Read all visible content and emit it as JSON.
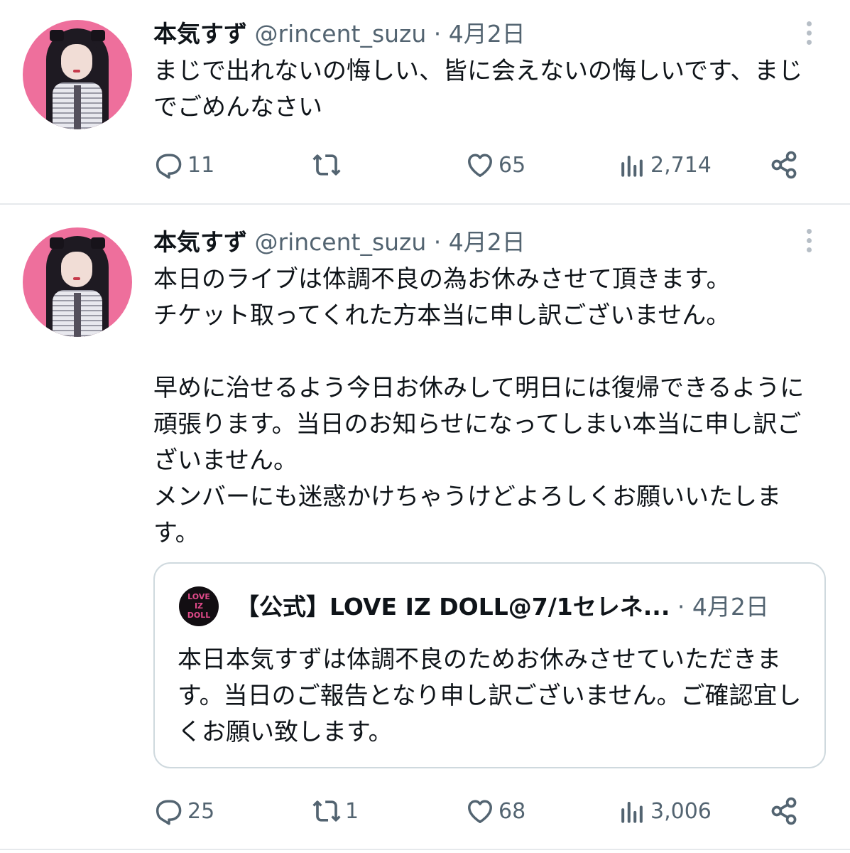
{
  "tweets": [
    {
      "author_name": "本気すず",
      "handle": "@rincent_suzu",
      "separator": "·",
      "date": "4月2日",
      "text": "まじで出れないの悔しい、皆に会えないの悔しいです、まじでごめんなさい",
      "reply_count": "11",
      "retweet_count": "",
      "like_count": "65",
      "view_count": "2,714"
    },
    {
      "author_name": "本気すず",
      "handle": "@rincent_suzu",
      "separator": "·",
      "date": "4月2日",
      "text": "本日のライブは体調不良の為お休みさせて頂きます。\nチケット取ってくれた方本当に申し訳ございません。\n\n早めに治せるよう今日お休みして明日には復帰できるように頑張ります。当日のお知らせになってしまい本当に申し訳ございません。\nメンバーにも迷惑かけちゃうけどよろしくお願いいたします。",
      "quote": {
        "author_name": "【公式】LOVE IZ DOLL@7/1セレネ...",
        "separator": "·",
        "date": "4月2日",
        "avatar_text": [
          "LOVE",
          "IZ",
          "DOLL"
        ],
        "text": "本日本気すずは体調不良のためお休みさせていただきます。当日のご報告となり申し訳ございません。ご確認宜しくお願い致します。"
      },
      "reply_count": "25",
      "retweet_count": "1",
      "like_count": "68",
      "view_count": "3,006"
    }
  ],
  "icons": {
    "reply": "reply-icon",
    "retweet": "retweet-icon",
    "like": "heart-icon",
    "views": "views-icon",
    "share": "share-icon",
    "more": "more-vertical-icon"
  },
  "colors": {
    "text": "#0f1419",
    "secondary": "#536471",
    "border": "#cfd9de",
    "divider": "#e6e9ec"
  }
}
